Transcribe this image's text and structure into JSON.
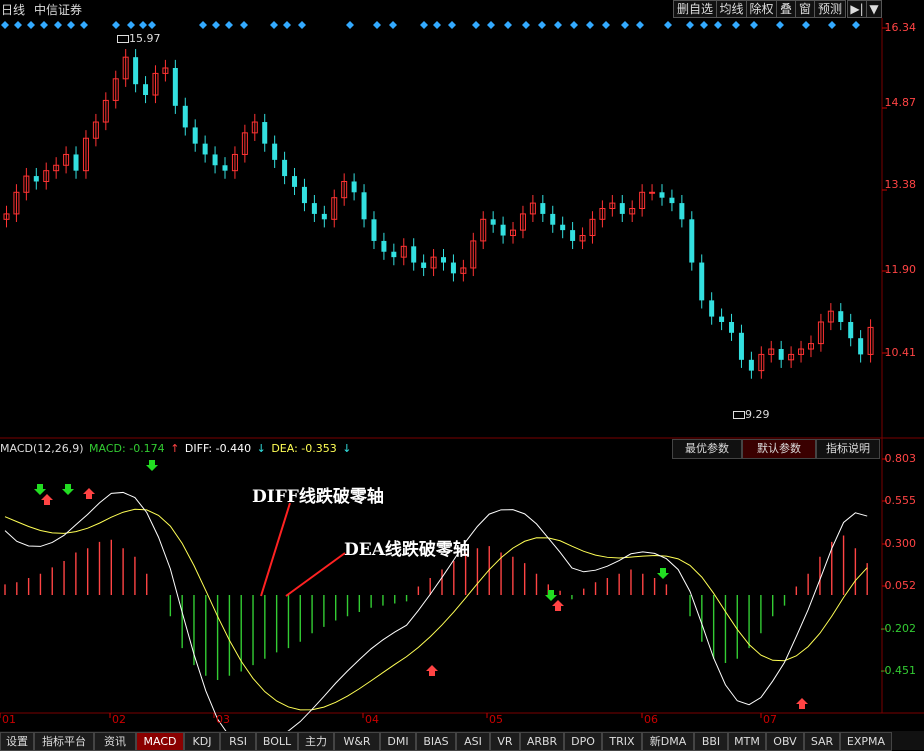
{
  "window": {
    "period": "日线",
    "stock_name": "中信证券"
  },
  "toolbar": {
    "buttons": [
      {
        "label": "删自选"
      },
      {
        "label": "均线"
      },
      {
        "label": "除权"
      },
      {
        "label": "叠"
      },
      {
        "label": "窗"
      },
      {
        "label": "预测"
      }
    ],
    "next_icon": "▶|",
    "dropdown_icon": "▼"
  },
  "price_axis": {
    "labels": [
      "16.34",
      "14.87",
      "13.38",
      "11.90",
      "10.41"
    ]
  },
  "price_marks": {
    "high": "15.97",
    "low": "9.29"
  },
  "macd_header": {
    "name": "MACD(12,26,9)",
    "macd": "MACD: -0.174",
    "macd_arrow": "↑",
    "diff": "DIFF: -0.440",
    "diff_arrow": "↓",
    "dea": "DEA: -0.353",
    "dea_arrow": "↓"
  },
  "macd_tabs": [
    {
      "label": "最优参数"
    },
    {
      "label": "默认参数"
    },
    {
      "label": "指标说明"
    }
  ],
  "macd_axis": {
    "labels": [
      "0.803",
      "0.555",
      "0.300",
      "0.052",
      "-0.202",
      "-0.451"
    ]
  },
  "annotations": {
    "diff_cross": "DIFF线跌破零轴",
    "dea_cross": "DEA线跌破零轴"
  },
  "months": [
    "01",
    "02",
    "03",
    "04",
    "05",
    "06",
    "07"
  ],
  "bottom_tabs": [
    {
      "label": "设置"
    },
    {
      "label": "指标平台"
    },
    {
      "label": "资讯"
    },
    {
      "label": "MACD"
    },
    {
      "label": "KDJ"
    },
    {
      "label": "RSI"
    },
    {
      "label": "BOLL"
    },
    {
      "label": "主力"
    },
    {
      "label": "W&R"
    },
    {
      "label": "DMI"
    },
    {
      "label": "BIAS"
    },
    {
      "label": "ASI"
    },
    {
      "label": "VR"
    },
    {
      "label": "ARBR"
    },
    {
      "label": "DPO"
    },
    {
      "label": "TRIX"
    },
    {
      "label": "新DMA"
    },
    {
      "label": "BBI"
    },
    {
      "label": "MTM"
    },
    {
      "label": "OBV"
    },
    {
      "label": "SAR"
    },
    {
      "label": "EXPMA"
    }
  ],
  "colors": {
    "up": "#ff3333",
    "down": "#33e0e0",
    "macd_pos": "#ff4444",
    "macd_neg": "#33cc33",
    "diff_line": "#ffffff",
    "dea_line": "#ffff55",
    "grid": "#7a0000"
  },
  "chart_data": {
    "type": "candlestick",
    "price_candles_close_approx": [
      12.9,
      13.3,
      13.6,
      13.5,
      13.7,
      13.8,
      14.0,
      13.7,
      14.3,
      14.6,
      15.0,
      15.4,
      15.8,
      15.3,
      15.1,
      15.5,
      15.6,
      14.9,
      14.5,
      14.2,
      14.0,
      13.8,
      13.7,
      14.0,
      14.4,
      14.6,
      14.2,
      13.9,
      13.6,
      13.4,
      13.1,
      12.9,
      12.8,
      13.2,
      13.5,
      13.3,
      12.8,
      12.4,
      12.2,
      12.1,
      12.3,
      12.0,
      11.9,
      12.1,
      12.0,
      11.8,
      11.9,
      12.4,
      12.8,
      12.7,
      12.5,
      12.6,
      12.9,
      13.1,
      12.9,
      12.7,
      12.6,
      12.4,
      12.5,
      12.8,
      13.0,
      13.1,
      12.9,
      13.0,
      13.3,
      13.3,
      13.2,
      13.1,
      12.8,
      12.0,
      11.3,
      11.0,
      10.9,
      10.7,
      10.2,
      10.0,
      10.3,
      10.4,
      10.2,
      10.3,
      10.4,
      10.5,
      10.9,
      11.1,
      10.9,
      10.6,
      10.3,
      10.8
    ],
    "macd_hist_approx": [
      0.05,
      0.06,
      0.08,
      0.1,
      0.13,
      0.16,
      0.2,
      0.22,
      0.25,
      0.26,
      0.22,
      0.18,
      0.1,
      0.0,
      -0.1,
      -0.25,
      -0.33,
      -0.38,
      -0.4,
      -0.38,
      -0.36,
      -0.33,
      -0.3,
      -0.27,
      -0.25,
      -0.22,
      -0.18,
      -0.15,
      -0.12,
      -0.1,
      -0.08,
      -0.06,
      -0.05,
      -0.04,
      -0.03,
      0.04,
      0.08,
      0.12,
      0.16,
      0.2,
      0.22,
      0.23,
      0.2,
      0.18,
      0.15,
      0.1,
      0.05,
      0.02,
      -0.02,
      0.03,
      0.06,
      0.08,
      0.1,
      0.12,
      0.1,
      0.08,
      0.05,
      0.0,
      -0.1,
      -0.22,
      -0.3,
      -0.32,
      -0.3,
      -0.25,
      -0.18,
      -0.1,
      -0.05,
      0.04,
      0.1,
      0.18,
      0.25,
      0.28,
      0.22,
      0.15
    ]
  }
}
